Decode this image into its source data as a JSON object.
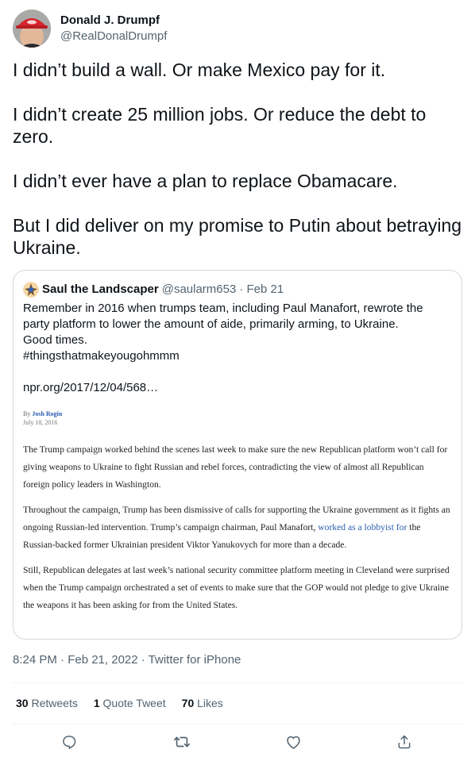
{
  "tweet": {
    "author_name": "Donald J. Drumpf",
    "author_handle": "@RealDonalDrumpf",
    "paragraphs": [
      "I didn’t build a wall. Or make Mexico pay for it.",
      "I didn’t create 25 million jobs. Or reduce the debt to zero.",
      "I didn’t ever have a plan to replace Obamacare.",
      "But I did deliver on my promise to Putin about betraying Ukraine."
    ],
    "timestamp": "8:24 PM · Feb 21, 2022 · Twitter for iPhone"
  },
  "quote": {
    "author_name": "Saul the Landscaper",
    "author_handle": "@saularm653",
    "date": "· Feb 21",
    "lines": [
      "Remember in 2016 when trumps team, including Paul Manafort, rewrote the",
      "party platform to lower the amount of aide, primarily arming, to Ukraine.",
      "Good times.",
      "#thingsthatmakeyougohmmm"
    ],
    "link": "npr.org/2017/12/04/568…",
    "article": {
      "by": "By",
      "author": "Josh Rogin",
      "date": "July 18, 2016",
      "p1": "The Trump campaign worked behind the scenes last week to make sure the new Republican platform won’t call for giving weapons to Ukraine to fight Russian and rebel forces, contradicting the view of almost all Republican foreign policy leaders in Washington.",
      "p2_before": "Throughout the campaign, Trump has been dismissive of calls for supporting the Ukraine government as it fights an ongoing Russian-led intervention. Trump’s campaign chairman, Paul Manafort,",
      "p2_link": "worked as a lobbyist for",
      "p2_after": "the Russian-backed former Ukrainian president Viktor Yanukovych for more than a decade.",
      "p3": "Still, Republican delegates at last week’s national security committee platform meeting in Cleveland were surprised when the Trump campaign orchestrated a set of events to make sure that the GOP would not pledge to give Ukraine the weapons it has been asking for from the United States."
    }
  },
  "stats": {
    "retweets_count": "30",
    "retweets_label": "Retweets",
    "quotes_count": "1",
    "quotes_label": "Quote Tweet",
    "likes_count": "70",
    "likes_label": "Likes"
  },
  "icons": {
    "reply": "reply-icon",
    "retweet": "retweet-icon",
    "like": "like-icon",
    "share": "share-icon"
  },
  "colors": {
    "text": "#0f1419",
    "secondary": "#536471",
    "border": "#cfd9de",
    "link": "#2a5db0"
  }
}
